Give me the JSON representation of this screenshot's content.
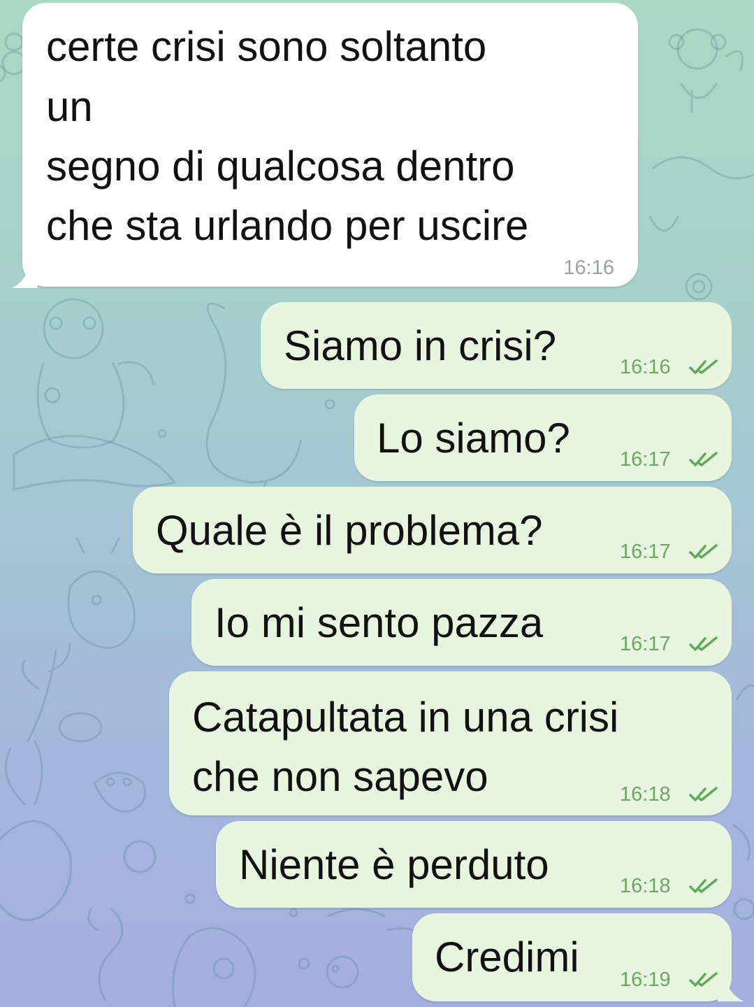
{
  "chat": {
    "messages": [
      {
        "direction": "incoming",
        "lines": [
          "certe crisi sono soltanto",
          "un",
          "segno di qualcosa dentro",
          "che sta urlando per uscire"
        ],
        "time": "16:16"
      },
      {
        "direction": "outgoing",
        "text": "Siamo in crisi?",
        "time": "16:16",
        "status": "read"
      },
      {
        "direction": "outgoing",
        "text": "Lo siamo?",
        "time": "16:17",
        "status": "read"
      },
      {
        "direction": "outgoing",
        "text": "Quale è il problema?",
        "time": "16:17",
        "status": "read"
      },
      {
        "direction": "outgoing",
        "text": "Io mi sento pazza",
        "time": "16:17",
        "status": "read"
      },
      {
        "direction": "outgoing",
        "lines": [
          "Catapultata in una crisi",
          "che non sapevo"
        ],
        "time": "16:18",
        "status": "read"
      },
      {
        "direction": "outgoing",
        "text": "Niente è perduto",
        "time": "16:18",
        "status": "read"
      },
      {
        "direction": "outgoing",
        "text": "Credimi",
        "time": "16:19",
        "status": "read"
      }
    ]
  },
  "colors": {
    "incoming_bubble": "#ffffff",
    "outgoing_bubble": "#e8f6e0",
    "read_check": "#5cab59",
    "outgoing_time": "#6aa863",
    "incoming_time": "#9aa2a6"
  },
  "icons": {
    "read_status": "double-check-icon",
    "background": "doodle-pattern"
  }
}
